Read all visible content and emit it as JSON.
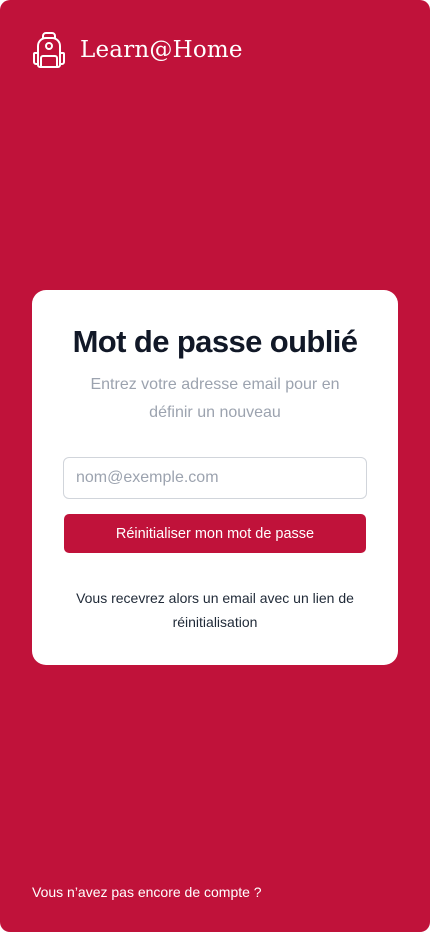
{
  "brand": {
    "logo_icon": "backpack-icon",
    "name": "Learn@Home"
  },
  "card": {
    "title": "Mot de passe oublié",
    "subtitle": "Entrez votre adresse email pour en définir un nouveau",
    "email_input": {
      "value": "",
      "placeholder": "nom@exemple.com"
    },
    "submit_label": "Réinitialiser mon mot de passe",
    "note": "Vous recevrez alors un email avec un lien de réinitialisation"
  },
  "footer": {
    "signup_prompt": "Vous n’avez pas encore de compte ?"
  },
  "colors": {
    "brand": "#c0123a",
    "card_background": "#ffffff",
    "title_text": "#111827",
    "muted_text": "#9ca3af"
  }
}
